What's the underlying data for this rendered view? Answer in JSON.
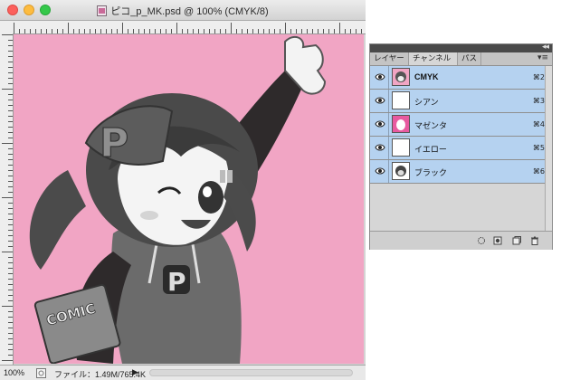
{
  "document": {
    "title": "ピコ_p_MK.psd @ 100% (CMYK/8)",
    "canvas_color": "#f1a5c4",
    "comic_label": "COMIC",
    "cap_letter": "P",
    "shirt_letter": "P"
  },
  "status": {
    "zoom": "100%",
    "doc_info": "ファイル：1.49M/765.4K"
  },
  "panel": {
    "tabs": [
      "レイヤー",
      "チャンネル",
      "パス"
    ],
    "active_tab": "チャンネル",
    "channels": [
      {
        "name": "CMYK",
        "shortcut": "⌘2"
      },
      {
        "name": "シアン",
        "shortcut": "⌘3"
      },
      {
        "name": "マゼンタ",
        "shortcut": "⌘4"
      },
      {
        "name": "イエロー",
        "shortcut": "⌘5"
      },
      {
        "name": "ブラック",
        "shortcut": "⌘6"
      }
    ],
    "selection_color": "#b5d2f0"
  }
}
